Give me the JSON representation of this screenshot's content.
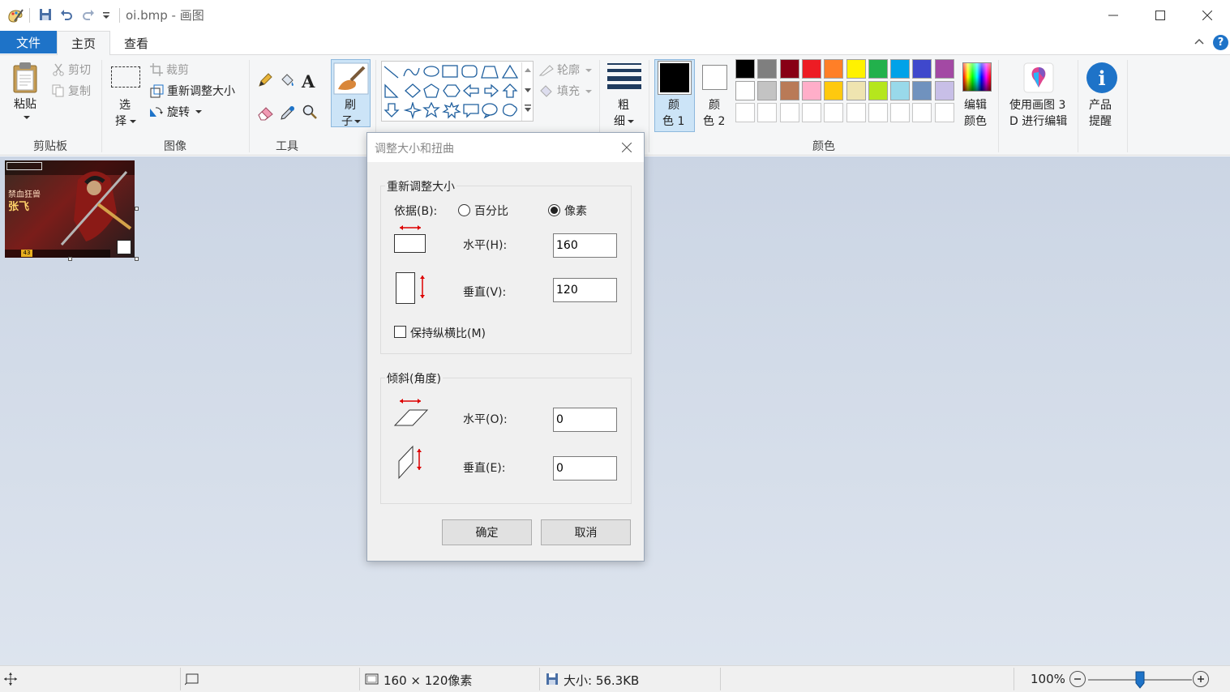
{
  "window": {
    "title": "oi.bmp - 画图"
  },
  "tabs": {
    "file": "文件",
    "home": "主页",
    "view": "查看"
  },
  "ribbon": {
    "clipboard": {
      "paste": "粘贴",
      "cut": "剪切",
      "copy": "复制",
      "group": "剪贴板"
    },
    "image": {
      "select_l1": "选",
      "select_l2": "择",
      "crop": "裁剪",
      "resize": "重新调整大小",
      "rotate": "旋转",
      "group": "图像"
    },
    "tools": {
      "group": "工具"
    },
    "brushes": {
      "l1": "刷",
      "l2": "子"
    },
    "shapes": {
      "outline": "轮廓",
      "fill": "填充"
    },
    "size": {
      "l1": "粗",
      "l2": "细"
    },
    "colors": {
      "color1_l1": "颜",
      "color1_l2": "色 1",
      "color2_l1": "颜",
      "color2_l2": "色 2",
      "edit_l1": "编辑",
      "edit_l2": "颜色",
      "group": "颜色",
      "palette_row1": [
        "#000000",
        "#7f7f7f",
        "#880015",
        "#ed1c24",
        "#ff7f27",
        "#fff200",
        "#22b14c",
        "#00a2e8",
        "#3f48cc",
        "#a349a4"
      ],
      "palette_row2": [
        "#ffffff",
        "#c3c3c3",
        "#b97a57",
        "#ffaec9",
        "#ffc90e",
        "#efe4b0",
        "#b5e61d",
        "#99d9ea",
        "#7092be",
        "#c8bfe7"
      ]
    },
    "paint3d": {
      "l1": "使用画图 3",
      "l2": "D 进行编辑"
    },
    "product": {
      "l1": "产品",
      "l2": "提醒"
    }
  },
  "dialog": {
    "title": "调整大小和扭曲",
    "resize_section": "重新调整大小",
    "by_label": "依据(B):",
    "percent": "百分比",
    "pixels": "像素",
    "horizontal_label": "水平(H):",
    "horizontal_value": "160",
    "vertical_label": "垂直(V):",
    "vertical_value": "120",
    "keep_ratio": "保持纵横比(M)",
    "skew_section": "倾斜(角度)",
    "skew_h_label": "水平(O):",
    "skew_h_value": "0",
    "skew_v_label": "垂直(E):",
    "skew_v_value": "0",
    "ok": "确定",
    "cancel": "取消"
  },
  "thumbnail": {
    "line1": "禁血狂兽",
    "line2": "张飞",
    "corner": "43"
  },
  "status": {
    "dimensions": "160 × 120像素",
    "size": "大小: 56.3KB",
    "zoom": "100%"
  }
}
